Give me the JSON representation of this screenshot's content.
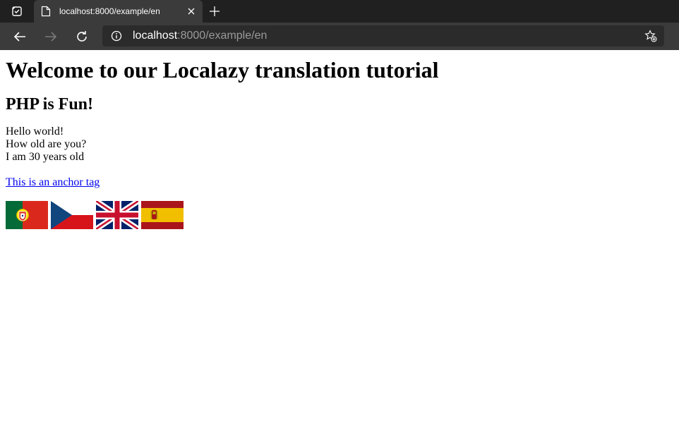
{
  "browser": {
    "tab_title": "localhost:8000/example/en",
    "url_host": "localhost",
    "url_rest": ":8000/example/en"
  },
  "page": {
    "heading": "Welcome to our Localazy translation tutorial",
    "subheading": "PHP is Fun!",
    "lines": [
      "Hello world!",
      "How old are you?",
      "I am 30 years old"
    ],
    "link_text": "This is an anchor tag",
    "flags": [
      "portugal-flag",
      "czech-flag",
      "uk-flag",
      "spain-flag"
    ]
  },
  "colors": {
    "chrome_dark": "#202020",
    "chrome_tab": "#3b3b3b",
    "link": "#0000ee"
  }
}
